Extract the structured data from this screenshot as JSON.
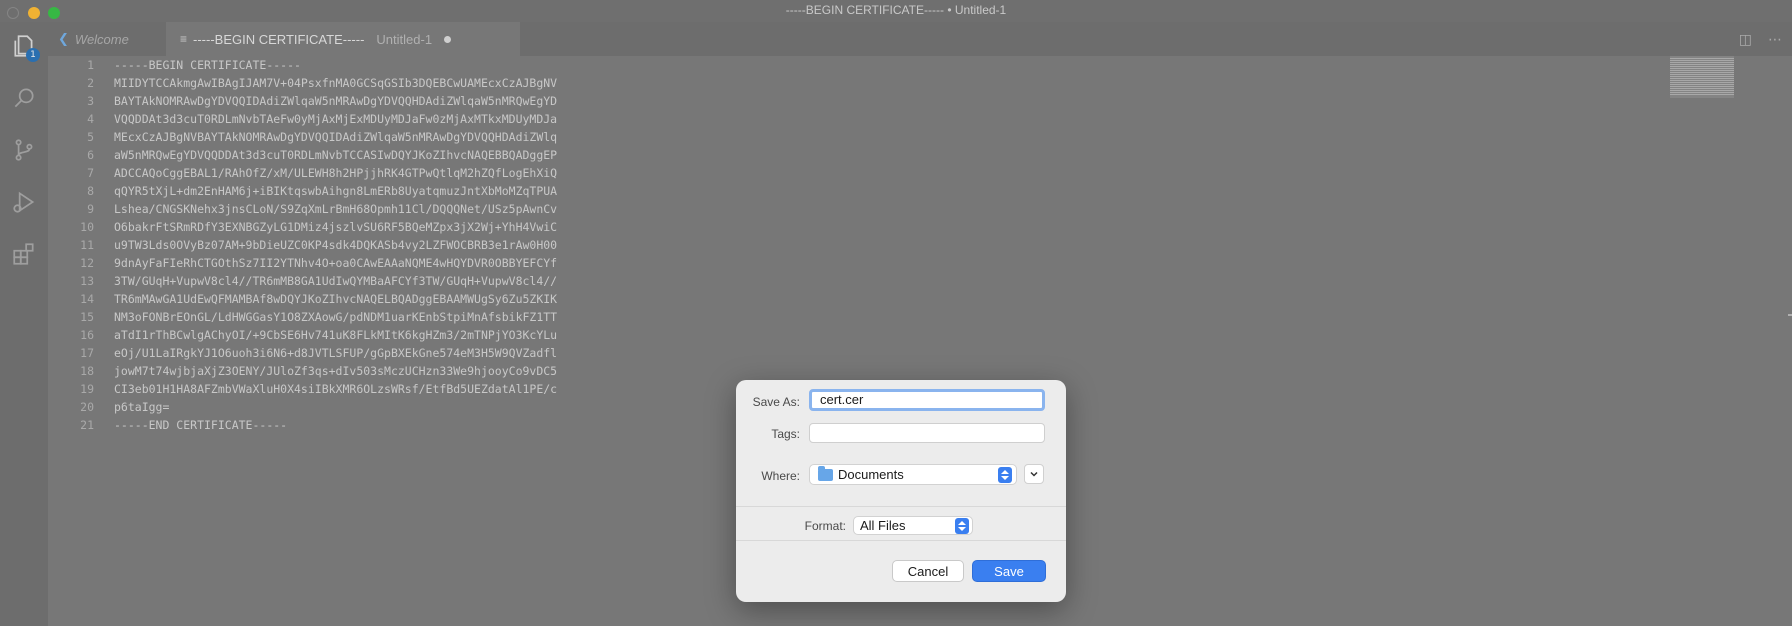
{
  "window": {
    "title": "-----BEGIN CERTIFICATE----- • Untitled-1"
  },
  "activity_bar": {
    "items": [
      {
        "icon": "files-icon",
        "badge": "1"
      },
      {
        "icon": "search-icon"
      },
      {
        "icon": "source-control-icon"
      },
      {
        "icon": "run-debug-icon"
      },
      {
        "icon": "extensions-icon"
      }
    ]
  },
  "tabs": [
    {
      "label": "Welcome"
    },
    {
      "label": "-----BEGIN CERTIFICATE-----",
      "sublabel": "Untitled-1",
      "dirty": true
    }
  ],
  "editor": {
    "line_numbers": [
      "1",
      "2",
      "3",
      "4",
      "5",
      "6",
      "7",
      "8",
      "9",
      "10",
      "11",
      "12",
      "13",
      "14",
      "15",
      "16",
      "17",
      "18",
      "19",
      "20",
      "21"
    ],
    "lines": [
      "-----BEGIN CERTIFICATE-----",
      "MIIDYTCCAkmgAwIBAgIJAM7V+04PsxfnMA0GCSqGSIb3DQEBCwUAMEcxCzAJBgNV",
      "BAYTAkNOMRAwDgYDVQQIDAdiZWlqaW5nMRAwDgYDVQQHDAdiZWlqaW5nMRQwEgYD",
      "VQQDDAt3d3cuT0RDLmNvbTAeFw0yMjAxMjExMDUyMDJaFw0zMjAxMTkxMDUyMDJa",
      "MEcxCzAJBgNVBAYTAkNOMRAwDgYDVQQIDAdiZWlqaW5nMRAwDgYDVQQHDAdiZWlq",
      "aW5nMRQwEgYDVQQDDAt3d3cuT0RDLmNvbTCCASIwDQYJKoZIhvcNAQEBBQADggEP",
      "ADCCAQoCggEBAL1/RAhOfZ/xM/ULEWH8h2HPjjhRK4GTPwQtlqM2hZQfLogEhXiQ",
      "qQYR5tXjL+dm2EnHAM6j+iBIKtqswbAihgn8LmERb8UyatqmuzJntXbMoMZqTPUA",
      "Lshea/CNGSKNehx3jnsCLoN/S9ZqXmLrBmH68Opmh11Cl/DQQQNet/USz5pAwnCv",
      "O6bakrFtSRmRDfY3EXNBGZyLG1DMiz4jszlvSU6RF5BQeMZpx3jX2Wj+YhH4VwiC",
      "u9TW3Lds0OVyBz07AM+9bDieUZC0KP4sdk4DQKASb4vy2LZFWOCBRB3e1rAw0H00",
      "9dnAyFaFIeRhCTGOthSz7II2YTNhv4O+oa0CAwEAAaNQME4wHQYDVR0OBBYEFCYf",
      "3TW/GUqH+VupwV8cl4//TR6mMB8GA1UdIwQYMBaAFCYf3TW/GUqH+VupwV8cl4//",
      "TR6mMAwGA1UdEwQFMAMBAf8wDQYJKoZIhvcNAQELBQADggEBAAMWUgSy6Zu5ZKIK",
      "NM3oFONBrEOnGL/LdHWGGasY1O8ZXAowG/pdNDM1uarKEnbStpiMnAfsbikFZ1TT",
      "aTdI1rThBCwlgAChyOI/+9CbSE6Hv741uK8FLkMItK6kgHZm3/2mTNPjYO3KcYLu",
      "eOj/U1LaIRgkYJ1O6uoh3i6N6+d8JVTLSFUP/gGpBXEkGne574eM3H5W9QVZadfl",
      "jowM7t74wjbjaXjZ3OENY/JUloZf3qs+dIv503sMczUCHzn33We9hjooyCo9vDC5",
      "CI3eb01H1HA8AFZmbVWaXluH0X4siIBkXMR6OLzsWRsf/EtfBd5UEZdatAl1PE/c",
      "p6taIgg=",
      "-----END CERTIFICATE-----"
    ]
  },
  "dialog": {
    "save_as_label": "Save As:",
    "save_as_value": "cert.cer",
    "tags_label": "Tags:",
    "tags_value": "",
    "where_label": "Where:",
    "where_value": "Documents",
    "format_label": "Format:",
    "format_value": "All Files",
    "cancel_label": "Cancel",
    "save_label": "Save",
    "accent_color": "#3a7ff0"
  }
}
